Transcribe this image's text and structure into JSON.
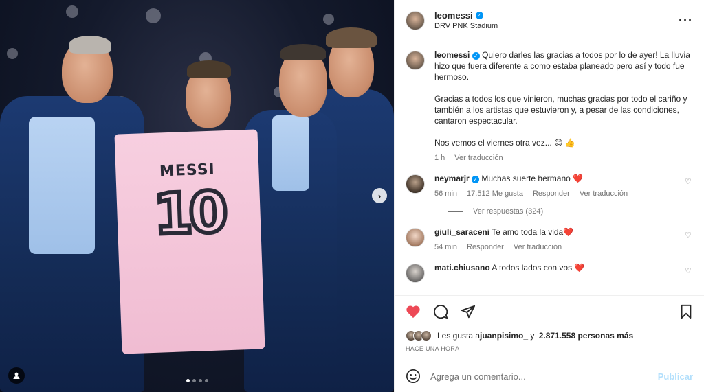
{
  "post": {
    "username": "leomessi",
    "location": "DRV PNK Stadium",
    "caption_p1": "Quiero darles las gracias a todos por lo de ayer! La lluvia hizo que fuera diferente a como estaba planeado pero así y todo fue hermoso.",
    "caption_p2": "Gracias a todos los que vinieron, muchas gracias por todo el cariño y también a los artistas que estuvieron y, a pesar de las condiciones, cantaron espectacular.",
    "caption_p3": "Nos vemos el viernes otra vez... 😊 👍",
    "caption_time": "1 h",
    "caption_translate": "Ver traducción"
  },
  "media": {
    "jersey_name": "MESSI",
    "jersey_number": "10",
    "carousel_dots": 4,
    "carousel_active": 0
  },
  "comments": [
    {
      "user": "neymarjr",
      "verified": true,
      "text": "Muchas suerte hermano ❤️",
      "time": "56 min",
      "likes": "17.512 Me gusta",
      "reply": "Responder",
      "translate": "Ver traducción",
      "view_replies": "Ver respuestas (324)"
    },
    {
      "user": "giuli_saraceni",
      "verified": false,
      "text": "Te amo toda la vida❤️",
      "time": "54 min",
      "reply": "Responder",
      "translate": "Ver traducción"
    },
    {
      "user": "mati.chiusano",
      "verified": false,
      "text": "A todos lados con vos ❤️"
    }
  ],
  "likes": {
    "prefix": "Les gusta a ",
    "user": "juanpisimo_",
    "middle": " y ",
    "count": "2.871.558 personas más"
  },
  "timestamp": "HACE UNA HORA",
  "composer": {
    "placeholder": "Agrega un comentario...",
    "post_label": "Publicar"
  },
  "colors": {
    "like_red": "#ed4956",
    "verified_blue": "#0095f6",
    "publish_disabled": "#b2dffc"
  }
}
